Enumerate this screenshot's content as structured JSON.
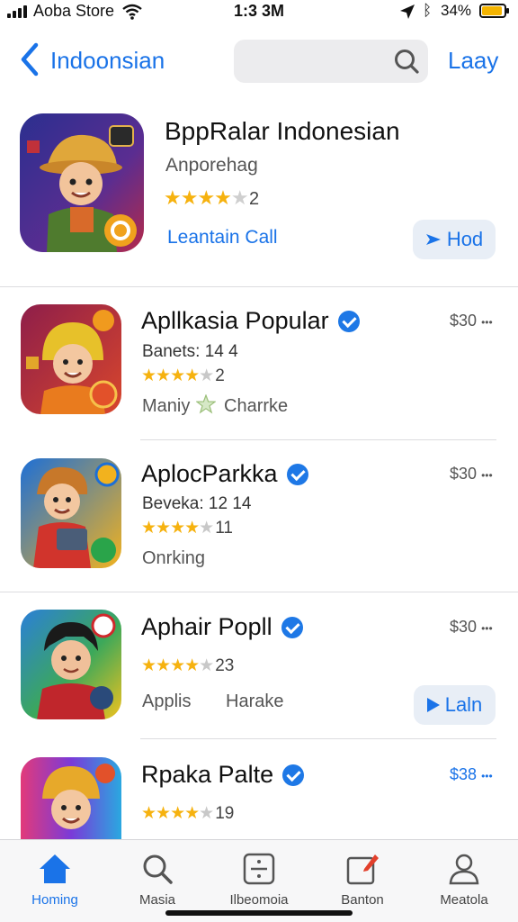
{
  "status_bar": {
    "carrier": "Aoba Store",
    "time": "1:3 3M",
    "battery": "34%"
  },
  "nav": {
    "back_label": "Indoonsian",
    "right_link": "Laay"
  },
  "featured": {
    "title": "BppRalar Indonesian",
    "subtitle": "Anporehag",
    "stars": "★★★★",
    "rating_count": "2",
    "link": "Leantain Call",
    "button_label": "Hod"
  },
  "apps": [
    {
      "title": "Apllkasia Popular",
      "price": "$30",
      "meta": "Banets: 14 4",
      "stars": "★★★★",
      "rating_count": "2",
      "tags": [
        "Maniy",
        "Charrke"
      ]
    },
    {
      "title": "AplocParkka",
      "price": "$30",
      "meta": "Beveka: 12 14",
      "stars": "★★★★",
      "rating_count": "11",
      "tags": [
        "Onrking"
      ]
    },
    {
      "title": "Aphair Popll",
      "price": "$30",
      "stars": "★★★★",
      "rating_count": "23",
      "tags": [
        "Applis",
        "Harake"
      ],
      "button_label": "Laln"
    },
    {
      "title": "Rpaka Palte",
      "price": "$38",
      "stars": "★★★★",
      "rating_count": "19"
    }
  ],
  "tabs": [
    {
      "label": "Homing",
      "icon": "home-icon",
      "active": true
    },
    {
      "label": "Masia",
      "icon": "search-icon"
    },
    {
      "label": "Ilbeomoia",
      "icon": "divide-icon"
    },
    {
      "label": "Banton",
      "icon": "compose-icon"
    },
    {
      "label": "Meatola",
      "icon": "person-icon"
    }
  ],
  "colors": {
    "accent": "#1a73e8",
    "star": "#f6b20f",
    "verified": "#1e78e6",
    "battery": "#f4b400"
  }
}
